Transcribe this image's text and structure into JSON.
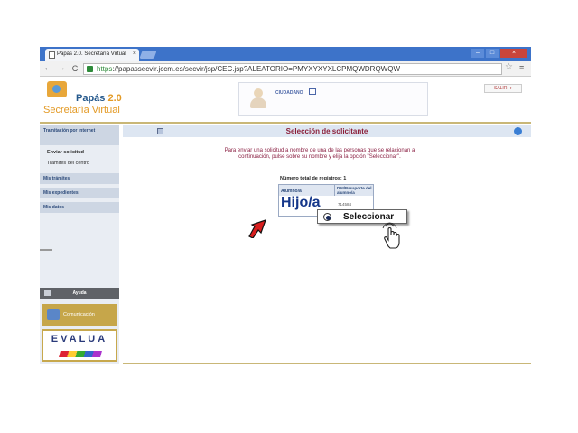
{
  "browser": {
    "tab_title": "Papás 2.0. Secretaría Virtual",
    "tab_close": "×",
    "url_https": "https",
    "url_rest": "://papassecvir.jccm.es/secvir/jsp/CEC.jsp?ALEATORIO=PMYXYXYXLCPMQWDRQWQW",
    "back": "←",
    "forward": "→",
    "reload": "C",
    "star": "☆",
    "menu": "≡",
    "win_min": "–",
    "win_max": "□",
    "win_close": "×"
  },
  "header": {
    "logo_title_main": "Papás ",
    "logo_title_version": "2.0",
    "logo_subtitle": "Secretaría Virtual",
    "user_label": "CIUDADANO",
    "logout": "SALIR ➜"
  },
  "sidebar": {
    "section_tramitacion": "Tramitación por Internet",
    "item_enviar": "Enviar solicitud",
    "item_tramites": "Trámites del centro",
    "section_mis_tramites": "Mis trámites",
    "section_mis_expedientes": "Mis expedientes",
    "section_mis_datos": "Mis datos",
    "ayuda": "Ayuda",
    "comunicacion": "Comunicación",
    "evalua": "EVALUA"
  },
  "main": {
    "title": "Selección de solicitante",
    "instructions": "Para enviar una solicitud a nombre de una de las personas que se relacionan a continuación, pulse sobre su nombre y elija la opción \"Seleccionar\".",
    "total": "Número total de registros: 1",
    "col_alumno": "Alumno/a",
    "col_dni": "DNI/Pasaporte del alumno/a",
    "row_name": "Hijo/a",
    "row_dni": "714584",
    "popup_label": "Seleccionar"
  },
  "colors": {
    "accent": "#8b1f3a",
    "brand_blue": "#24588c",
    "brand_orange": "#e39a25",
    "arrow_red": "#d81e1e"
  },
  "icons": [
    "star-icon",
    "menu-icon",
    "lock-icon",
    "avatar-icon",
    "arrow-pointer-icon",
    "hand-cursor-icon",
    "radio-icon"
  ]
}
